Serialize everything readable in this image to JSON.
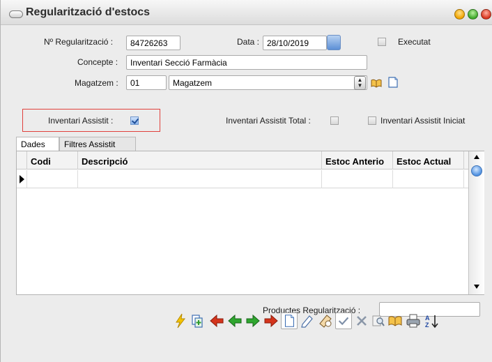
{
  "window": {
    "title": "Regularització d'estocs"
  },
  "form": {
    "num_label": "Nº Regularització :",
    "num_value": "84726263",
    "data_label": "Data :",
    "data_value": "28/10/2019",
    "executat_label": "Executat",
    "concepte_label": "Concepte :",
    "concepte_value": "Inventari Secció Farmàcia",
    "magatzem_label": "Magatzem :",
    "magatzem_code": "01",
    "magatzem_name": "Magatzem",
    "assistit_label": "Inventari Assistit :",
    "assistit_total_label": "Inventari Assistit Total :",
    "assistit_iniciat_label": "Inventari Assistit Iniciat"
  },
  "tabs": [
    "Dades",
    "Filtres Assistit"
  ],
  "grid": {
    "columns": [
      "Codi",
      "Descripció",
      "Estoc Anterio",
      "Estoc Actual"
    ]
  },
  "footer": {
    "productes_label": "Productes Regularització :",
    "productes_value": ""
  },
  "toolbar_icons": [
    "lightning-icon",
    "copy-icon",
    "first-record-icon",
    "previous-record-icon",
    "next-record-icon",
    "last-record-icon",
    "new-record-icon",
    "edit-icon",
    "cancel-edit-icon",
    "accept-icon",
    "delete-icon",
    "search-icon",
    "lookup-icon",
    "print-icon",
    "sort-icon"
  ],
  "colors": {
    "highlight_border": "#e0403c",
    "accent_blue": "#5c8fd6"
  }
}
